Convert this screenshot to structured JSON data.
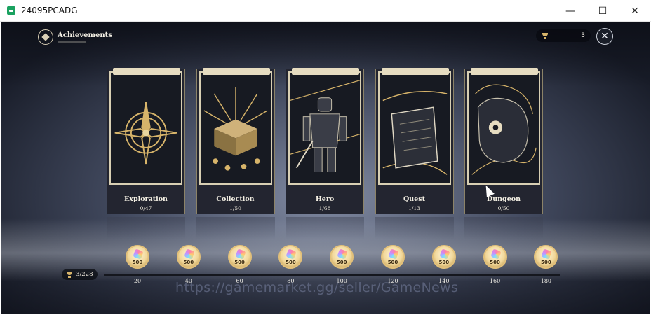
{
  "window": {
    "title": "24095PCADG",
    "minimize": "—",
    "maximize": "☐",
    "close": "✕"
  },
  "header": {
    "title": "Achievements",
    "icon": "achievement-emblem-icon"
  },
  "trophy_counter": {
    "value": "3",
    "icon": "trophy-icon"
  },
  "close_button": {
    "icon": "close-icon",
    "label": "✕"
  },
  "cards": [
    {
      "name": "Exploration",
      "progress": "0/47",
      "art": "compass"
    },
    {
      "name": "Collection",
      "progress": "1/50",
      "art": "chest"
    },
    {
      "name": "Hero",
      "progress": "1/68",
      "art": "knight"
    },
    {
      "name": "Quest",
      "progress": "1/13",
      "art": "scroll"
    },
    {
      "name": "Dungeon",
      "progress": "0/50",
      "art": "beast"
    }
  ],
  "points": {
    "value": "3/228",
    "icon": "trophy-icon"
  },
  "milestones": [
    {
      "threshold": "20",
      "reward": "500"
    },
    {
      "threshold": "40",
      "reward": "500"
    },
    {
      "threshold": "60",
      "reward": "500"
    },
    {
      "threshold": "80",
      "reward": "500"
    },
    {
      "threshold": "100",
      "reward": "500"
    },
    {
      "threshold": "120",
      "reward": "500"
    },
    {
      "threshold": "140",
      "reward": "500"
    },
    {
      "threshold": "160",
      "reward": "500"
    },
    {
      "threshold": "180",
      "reward": "500"
    }
  ],
  "watermark": "https://gamemarket.gg/seller/GameNews",
  "colors": {
    "gold": "#d7b46a",
    "parchment": "#e6dcc0",
    "card_bg": "#14161d"
  }
}
